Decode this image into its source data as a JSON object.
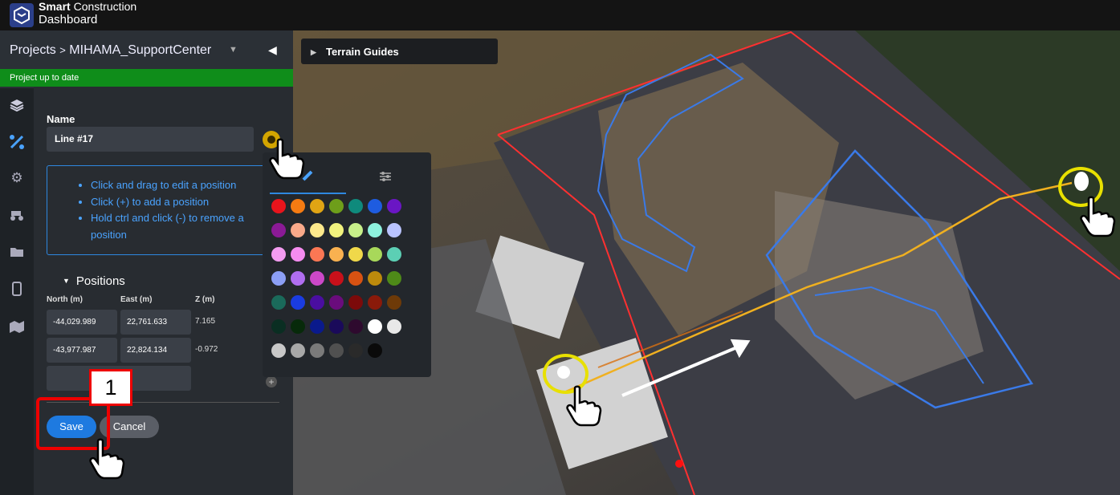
{
  "app": {
    "title_bold": "Smart",
    "title_light": "Construction",
    "title_line2": "Dashboard"
  },
  "breadcrumb": {
    "root": "Projects",
    "separator": ">",
    "project": "MIHAMA_SupportCenter"
  },
  "status": "Project up to date",
  "form": {
    "name_label": "Name",
    "name_value": "Line #17",
    "instructions": [
      "Click and drag to edit a position",
      "Click (+) to add a position",
      "Hold ctrl and click (-) to remove a position"
    ],
    "positions_label": "Positions",
    "columns": [
      "North (m)",
      "East (m)",
      "Z (m)"
    ],
    "rows": [
      {
        "north": "-44,029.989",
        "east": "22,761.633",
        "z": "7.165"
      },
      {
        "north": "-43,977.987",
        "east": "22,824.134",
        "z": "-0.972"
      }
    ],
    "save_label": "Save",
    "cancel_label": "Cancel"
  },
  "map": {
    "terrain_guides_label": "Terrain Guides"
  },
  "annotation": {
    "step_number": "1"
  },
  "colors": {
    "accent": "#2e88e0",
    "status_green": "#0f8d1a",
    "highlight_red": "#e00000",
    "highlight_yellow": "#e8e000",
    "palette": [
      [
        "#e8141c",
        "#f57b12",
        "#e0a414",
        "#6e9e1a",
        "#0f8a7c",
        "#1e5ce0",
        "#6a16c4"
      ],
      [
        "#8b1a96",
        "#f9a98a",
        "#fde98c",
        "#f1f27e",
        "#c8ef8a",
        "#8ef1de",
        "#b9c3ff"
      ],
      [
        "#f39cf0",
        "#f58cf0",
        "#fb7754",
        "#f9b150",
        "#f0d84a",
        "#a8d85a",
        "#5ccfb4"
      ],
      [
        "#8c9ff5",
        "#b06ef0",
        "#cc48c8",
        "#c8101a",
        "#d85212",
        "#bc8a0c",
        "#4e8a18"
      ],
      [
        "#1a6a5a",
        "#1a3ce0",
        "#4a0ea0",
        "#6a0c7c",
        "#7c0a0a",
        "#8a1a0a",
        "#6e3a08"
      ],
      [
        "#0a2e22",
        "#072a0a",
        "#0a1a8c",
        "#1a0a5a",
        "#2e0a2e",
        "#ffffff",
        "#e8e8e8"
      ],
      [
        "#c8c8c8",
        "#a8a8a8",
        "#7a7a7a",
        "#505050",
        "#2a2a2a",
        "#0a0a0a"
      ]
    ]
  },
  "icons": [
    "layers-icon",
    "line-tool-icon",
    "settings-icon",
    "machine-icon",
    "folder-icon",
    "mobile-icon",
    "map-icon",
    "chevron-down-icon",
    "collapse-icon",
    "triangle-right-icon",
    "triangle-down-icon",
    "palette-icon",
    "sliders-icon",
    "plus-icon",
    "hand-pointer-icon"
  ]
}
